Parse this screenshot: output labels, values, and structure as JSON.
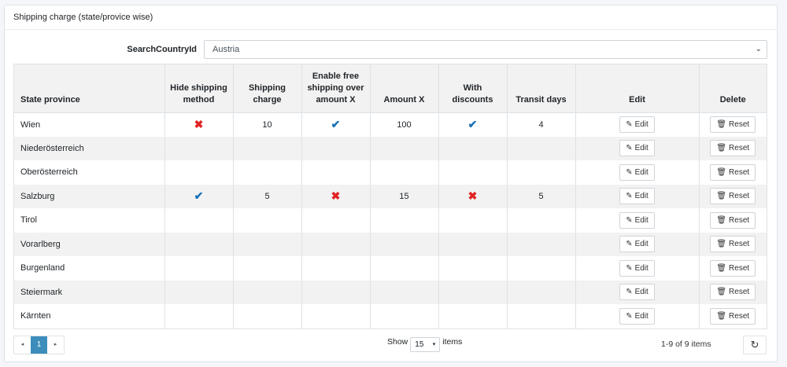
{
  "card": {
    "title": "Shipping charge (state/provice wise)"
  },
  "search": {
    "label": "SearchCountryId",
    "selected": "Austria"
  },
  "table": {
    "headers": {
      "state": "State province",
      "hide_line1": "Hide shipping",
      "hide_line2": "method",
      "charge": "Shipping charge",
      "free_line1": "Enable free",
      "free_line2": "shipping over",
      "free_line3": "amount X",
      "amount": "Amount X",
      "discounts": "With discounts",
      "transit": "Transit days",
      "edit": "Edit",
      "delete": "Delete"
    },
    "rows": [
      {
        "state": "Wien",
        "hide": "x",
        "charge": "10",
        "free": "check",
        "amount": "100",
        "discounts": "check",
        "transit": "4"
      },
      {
        "state": "Niederösterreich",
        "hide": "",
        "charge": "",
        "free": "",
        "amount": "",
        "discounts": "",
        "transit": ""
      },
      {
        "state": "Oberösterreich",
        "hide": "",
        "charge": "",
        "free": "",
        "amount": "",
        "discounts": "",
        "transit": ""
      },
      {
        "state": "Salzburg",
        "hide": "check",
        "charge": "5",
        "free": "x",
        "amount": "15",
        "discounts": "x",
        "transit": "5"
      },
      {
        "state": "Tirol",
        "hide": "",
        "charge": "",
        "free": "",
        "amount": "",
        "discounts": "",
        "transit": ""
      },
      {
        "state": "Vorarlberg",
        "hide": "",
        "charge": "",
        "free": "",
        "amount": "",
        "discounts": "",
        "transit": ""
      },
      {
        "state": "Burgenland",
        "hide": "",
        "charge": "",
        "free": "",
        "amount": "",
        "discounts": "",
        "transit": ""
      },
      {
        "state": "Steiermark",
        "hide": "",
        "charge": "",
        "free": "",
        "amount": "",
        "discounts": "",
        "transit": ""
      },
      {
        "state": "Kärnten",
        "hide": "",
        "charge": "",
        "free": "",
        "amount": "",
        "discounts": "",
        "transit": ""
      }
    ],
    "edit_label": "Edit",
    "reset_label": "Reset"
  },
  "pager": {
    "prev_icon": "◂",
    "current_page": "1",
    "next_icon": "▸"
  },
  "footer": {
    "show_label": "Show",
    "page_size": "15",
    "items_label": "items",
    "items_info": "1-9 of 9 items"
  },
  "icons": {
    "check": "✔",
    "x": "✖",
    "edit": "pencil-icon",
    "reset": "trash-icon",
    "refresh": "refresh-icon"
  },
  "colors": {
    "check": "#1a73b8",
    "x": "#e02424",
    "pager_active": "#3c8dbc"
  }
}
